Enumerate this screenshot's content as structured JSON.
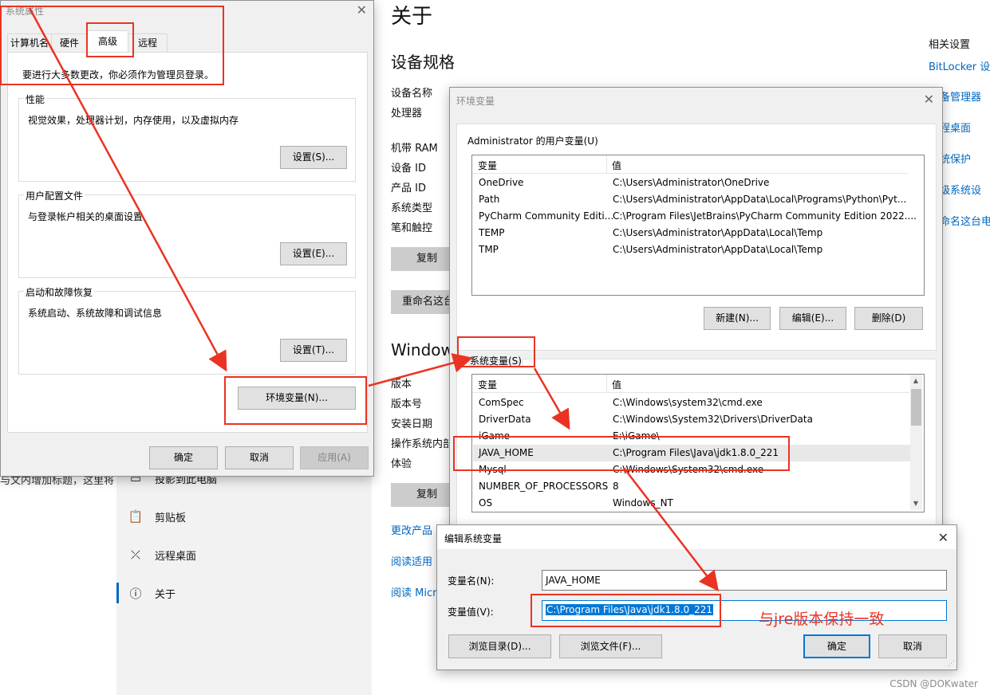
{
  "settings_page": {
    "title": "关于",
    "device_spec_heading": "设备规格",
    "spec_labels": [
      "设备名称",
      "处理器",
      "机带 RAM",
      "设备 ID",
      "产品 ID",
      "系统类型",
      "笔和触控"
    ],
    "copy_button": "复制",
    "rename_button": "重命名这台",
    "windows_heading": "Window",
    "win_labels": [
      "版本",
      "版本号",
      "安装日期",
      "操作系统内部",
      "体验"
    ],
    "copy_button_2": "复制",
    "links": [
      "更改产品",
      "阅读适用",
      "阅读 Micr"
    ],
    "related_heading": "相关设置",
    "related_links": [
      "BitLocker 设",
      "备管理器",
      "程桌面",
      "统保护",
      "级系统设",
      "命名这台电"
    ],
    "nav_items": [
      {
        "label": "投影到此电脑",
        "icon": "project-icon"
      },
      {
        "label": "剪贴板",
        "icon": "clipboard-icon"
      },
      {
        "label": "远程桌面",
        "icon": "remote-desktop-icon"
      },
      {
        "label": "关于",
        "icon": "info-icon"
      }
    ],
    "bg_text_fragment": "与文内增加标题，这里将"
  },
  "system_properties": {
    "title": "系统属性",
    "tabs": [
      "计算机名",
      "硬件",
      "高级",
      "远程"
    ],
    "admin_notice": "要进行大多数更改，你必须作为管理员登录。",
    "performance": {
      "title": "性能",
      "text": "视觉效果，处理器计划，内存使用，以及虚拟内存",
      "button": "设置(S)..."
    },
    "user_profiles": {
      "title": "用户配置文件",
      "text": "与登录帐户相关的桌面设置",
      "button": "设置(E)..."
    },
    "startup_recovery": {
      "title": "启动和故障恢复",
      "text": "系统启动、系统故障和调试信息",
      "button": "设置(T)..."
    },
    "env_button": "环境变量(N)...",
    "ok": "确定",
    "cancel": "取消",
    "apply": "应用(A)"
  },
  "env_vars": {
    "title": "环境变量",
    "user_group": "Administrator 的用户变量(U)",
    "col_var": "变量",
    "col_val": "值",
    "user_rows": [
      {
        "name": "OneDrive",
        "value": "C:\\Users\\Administrator\\OneDrive"
      },
      {
        "name": "Path",
        "value": "C:\\Users\\Administrator\\AppData\\Local\\Programs\\Python\\Pyt..."
      },
      {
        "name": "PyCharm Community Editi...",
        "value": "C:\\Program Files\\JetBrains\\PyCharm Community Edition 2022...."
      },
      {
        "name": "TEMP",
        "value": "C:\\Users\\Administrator\\AppData\\Local\\Temp"
      },
      {
        "name": "TMP",
        "value": "C:\\Users\\Administrator\\AppData\\Local\\Temp"
      }
    ],
    "user_buttons": [
      "新建(N)...",
      "编辑(E)...",
      "删除(D)"
    ],
    "system_group": "系统变量(S)",
    "system_rows": [
      {
        "name": "ComSpec",
        "value": "C:\\Windows\\system32\\cmd.exe"
      },
      {
        "name": "DriverData",
        "value": "C:\\Windows\\System32\\Drivers\\DriverData"
      },
      {
        "name": "iGame",
        "value": "E:\\iGame\\"
      },
      {
        "name": "JAVA_HOME",
        "value": "C:\\Program Files\\Java\\jdk1.8.0_221"
      },
      {
        "name": "Mysql",
        "value": "C:\\Windows\\System32\\cmd.exe"
      },
      {
        "name": "NUMBER_OF_PROCESSORS",
        "value": "8"
      },
      {
        "name": "OS",
        "value": "Windows_NT"
      }
    ]
  },
  "edit_var": {
    "title": "编辑系统变量",
    "name_label": "变量名(N):",
    "name_value": "JAVA_HOME",
    "value_label": "变量值(V):",
    "value_value": "C:\\Program Files\\Java\\jdk1.8.0_221",
    "browse_dir": "浏览目录(D)...",
    "browse_file": "浏览文件(F)...",
    "ok": "确定",
    "cancel": "取消"
  },
  "annotation": {
    "note": "与jre版本保持一致",
    "color": "#ea3323"
  },
  "watermark": "CSDN @DOKwater"
}
